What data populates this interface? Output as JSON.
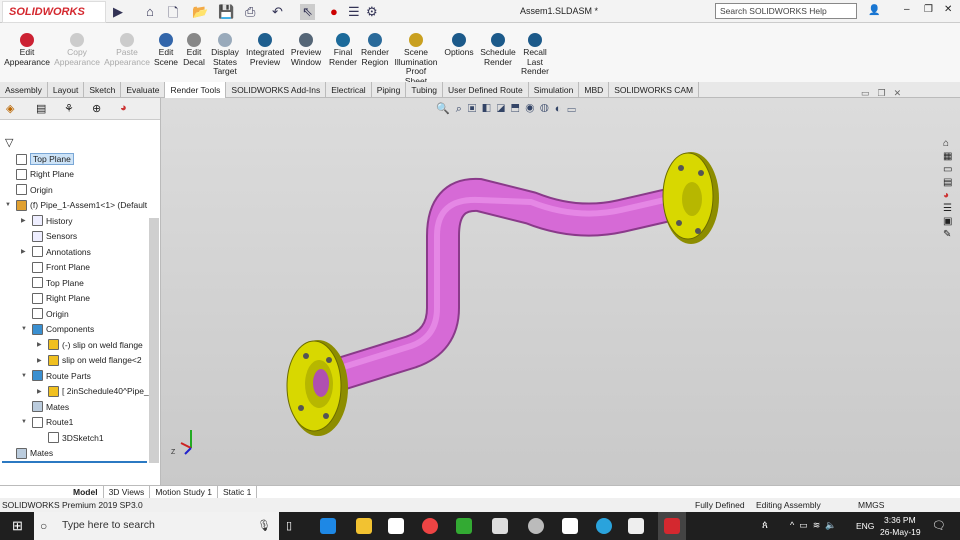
{
  "app": {
    "brand": "SOLIDWORKS",
    "title": "Assem1.SLDASM *",
    "search_placeholder": "Search SOLIDWORKS Help"
  },
  "ribbon": [
    {
      "label": "Edit Appearance",
      "enabled": true,
      "color": "#c23"
    },
    {
      "label": "Copy Appearance",
      "enabled": false,
      "color": "#ccc"
    },
    {
      "label": "Paste Appearance",
      "enabled": false,
      "color": "#ccc"
    },
    {
      "label": "Edit Scene",
      "enabled": true,
      "color": "#36a"
    },
    {
      "label": "Edit Decal",
      "enabled": true,
      "color": "#888"
    },
    {
      "label": "Display States Target",
      "enabled": true,
      "color": "#9ab"
    },
    {
      "label": "Integrated Preview",
      "enabled": true,
      "color": "#1f5f8f"
    },
    {
      "label": "Preview Window",
      "enabled": true,
      "color": "#567"
    },
    {
      "label": "Final Render",
      "enabled": true,
      "color": "#1c6a9a"
    },
    {
      "label": "Render Region",
      "enabled": true,
      "color": "#2a6a9a"
    },
    {
      "label": "Scene Illumination Proof Sheet",
      "enabled": true,
      "color": "#c9a020"
    },
    {
      "label": "Options",
      "enabled": true,
      "color": "#1c5a8a"
    },
    {
      "label": "Schedule Render",
      "enabled": true,
      "color": "#1c5a8a"
    },
    {
      "label": "Recall Last Render",
      "enabled": true,
      "color": "#1c5a8a"
    }
  ],
  "tabs": [
    "Assembly",
    "Layout",
    "Sketch",
    "Evaluate",
    "Render Tools",
    "SOLIDWORKS Add-Ins",
    "Electrical",
    "Piping",
    "Tubing",
    "User Defined Route",
    "Simulation",
    "MBD",
    "SOLIDWORKS CAM"
  ],
  "active_tab": "Render Tools",
  "tree": [
    {
      "label": "Top Plane",
      "level": 0,
      "selected": true,
      "icon": "plane"
    },
    {
      "label": "Right Plane",
      "level": 0,
      "icon": "plane"
    },
    {
      "label": "Origin",
      "level": 0,
      "icon": "origin"
    },
    {
      "label": "(f) Pipe_1-Assem1<1> (Default",
      "level": 0,
      "expand": "▼",
      "icon": "assembly"
    },
    {
      "label": "History",
      "level": 1,
      "expand": "▶",
      "icon": "folder"
    },
    {
      "label": "Sensors",
      "level": 1,
      "icon": "folder"
    },
    {
      "label": "Annotations",
      "level": 1,
      "expand": "▶",
      "icon": "annotation"
    },
    {
      "label": "Front Plane",
      "level": 1,
      "icon": "plane"
    },
    {
      "label": "Top Plane",
      "level": 1,
      "icon": "plane"
    },
    {
      "label": "Right Plane",
      "level": 1,
      "icon": "plane"
    },
    {
      "label": "Origin",
      "level": 1,
      "icon": "origin"
    },
    {
      "label": "Components",
      "level": 1,
      "expand": "▼",
      "icon": "folder-blue"
    },
    {
      "label": "(-) slip on weld flange",
      "level": 2,
      "expand": "▶",
      "icon": "part"
    },
    {
      "label": "slip on weld flange<2",
      "level": 2,
      "expand": "▶",
      "icon": "part"
    },
    {
      "label": "Route Parts",
      "level": 1,
      "expand": "▼",
      "icon": "folder-blue"
    },
    {
      "label": "[ 2inSchedule40^Pipe_",
      "level": 2,
      "expand": "▶",
      "icon": "part"
    },
    {
      "label": "Mates",
      "level": 1,
      "icon": "mates"
    },
    {
      "label": "Route1",
      "level": 1,
      "expand": "▼",
      "icon": "route"
    },
    {
      "label": "3DSketch1",
      "level": 2,
      "icon": "sketch3d"
    },
    {
      "label": "Mates",
      "level": 0,
      "icon": "mates"
    }
  ],
  "bottom_tabs": [
    "Model",
    "3D Views",
    "Motion Study 1",
    "Static 1"
  ],
  "status": {
    "product": "SOLIDWORKS Premium 2019 SP3.0",
    "defined": "Fully Defined",
    "mode": "Editing Assembly",
    "units": "MMGS"
  },
  "taskbar": {
    "search": "Type here to search",
    "lang": "ENG",
    "time": "3:36 PM",
    "date": "26-May-19"
  },
  "colors": {
    "pipe": "#d66ad6",
    "flange": "#d8d800",
    "viewport": "#d2d2d2"
  }
}
